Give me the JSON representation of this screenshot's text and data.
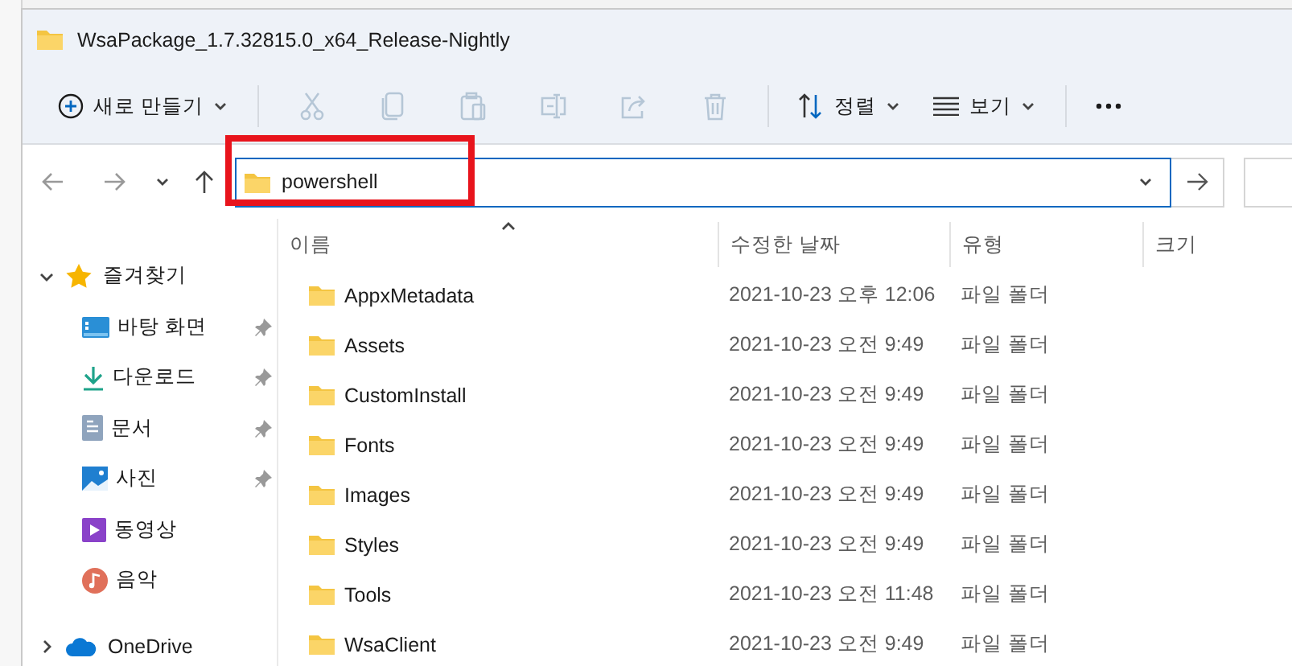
{
  "window": {
    "title": "WsaPackage_1.7.32815.0_x64_Release-Nightly"
  },
  "toolbar": {
    "new_button": {
      "label": "새로 만들기"
    },
    "actions": [
      {
        "kind": "cut",
        "disabled": true
      },
      {
        "kind": "copy",
        "disabled": true
      },
      {
        "kind": "paste",
        "disabled": true
      },
      {
        "kind": "rename",
        "disabled": true
      },
      {
        "kind": "share",
        "disabled": true
      },
      {
        "kind": "delete",
        "disabled": true
      }
    ],
    "sort_button": {
      "label": "정렬"
    },
    "view_button": {
      "label": "보기"
    }
  },
  "address_bar": {
    "value": "powershell",
    "highlighted": true
  },
  "sidebar": {
    "items": [
      {
        "label": "즐겨찾기",
        "kind": "star",
        "expanded": true,
        "children": [
          {
            "label": "바탕 화면",
            "kind": "desktop",
            "pinned": true
          },
          {
            "label": "다운로드",
            "kind": "download",
            "pinned": true
          },
          {
            "label": "문서",
            "kind": "document",
            "pinned": true
          },
          {
            "label": "사진",
            "kind": "picture",
            "pinned": true
          },
          {
            "label": "동영상",
            "kind": "video",
            "pinned": false
          },
          {
            "label": "음악",
            "kind": "music",
            "pinned": false
          }
        ]
      },
      {
        "label": "OneDrive",
        "kind": "cloud",
        "expanded": false
      }
    ]
  },
  "table": {
    "columns": [
      {
        "label": "이름",
        "sorted": true
      },
      {
        "label": "수정한 날짜",
        "sorted": false
      },
      {
        "label": "유형",
        "sorted": false
      },
      {
        "label": "크기",
        "sorted": false
      }
    ],
    "rows": [
      {
        "name": "AppxMetadata",
        "modified": "2021-10-23 오후 12:06",
        "type": "파일 폴더"
      },
      {
        "name": "Assets",
        "modified": "2021-10-23 오전 9:49",
        "type": "파일 폴더"
      },
      {
        "name": "CustomInstall",
        "modified": "2021-10-23 오전 9:49",
        "type": "파일 폴더"
      },
      {
        "name": "Fonts",
        "modified": "2021-10-23 오전 9:49",
        "type": "파일 폴더"
      },
      {
        "name": "Images",
        "modified": "2021-10-23 오전 9:49",
        "type": "파일 폴더"
      },
      {
        "name": "Styles",
        "modified": "2021-10-23 오전 9:49",
        "type": "파일 폴더"
      },
      {
        "name": "Tools",
        "modified": "2021-10-23 오전 11:48",
        "type": "파일 폴더"
      },
      {
        "name": "WsaClient",
        "modified": "2021-10-23 오전 9:49",
        "type": "파일 폴더"
      }
    ]
  }
}
